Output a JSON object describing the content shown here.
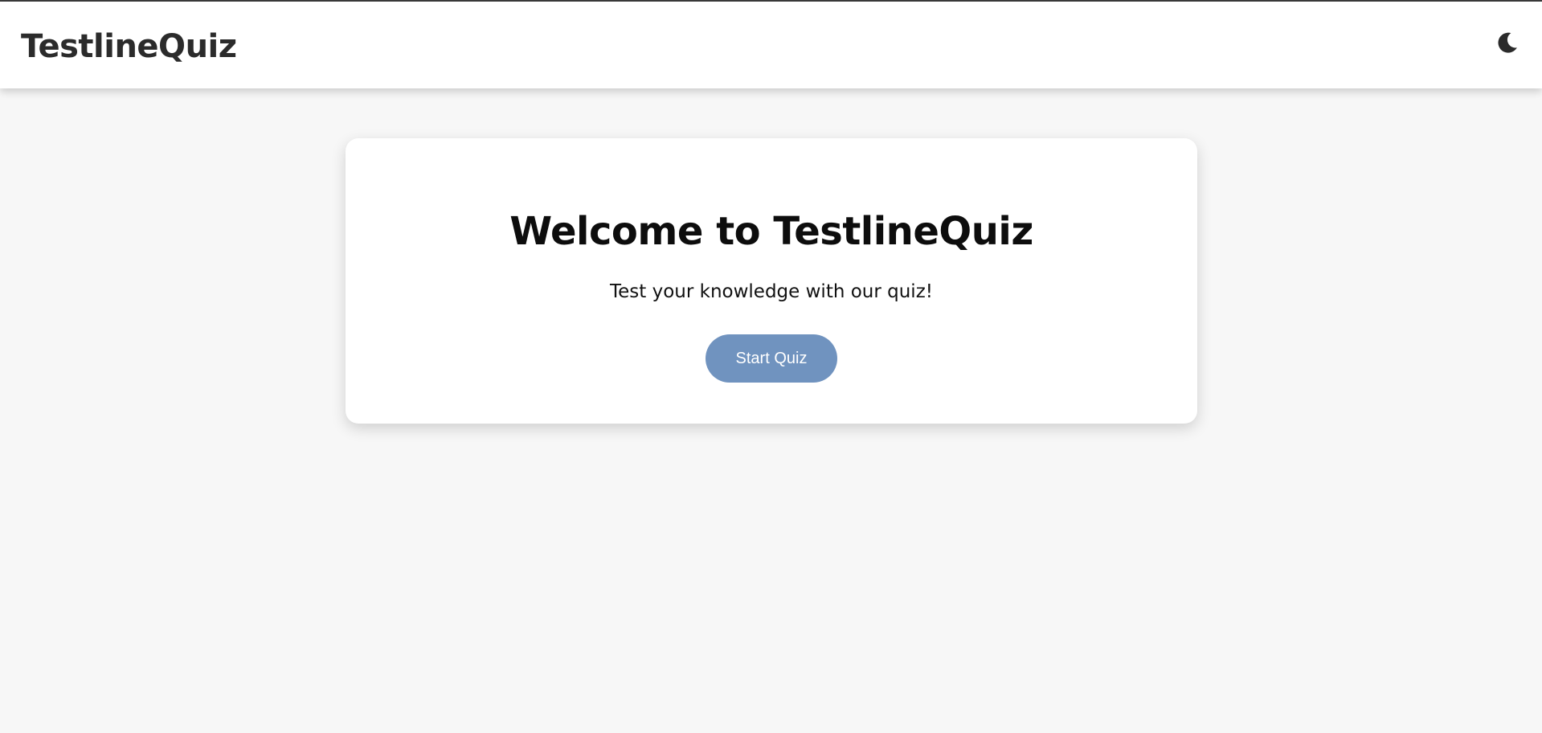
{
  "header": {
    "brand": "TestlineQuiz",
    "theme_toggle_icon": "moon-icon"
  },
  "welcome": {
    "title": "Welcome to TestlineQuiz",
    "subtitle": "Test your knowledge with our quiz!",
    "start_label": "Start Quiz"
  },
  "colors": {
    "background": "#f7f7f7",
    "accent": "#7093bf",
    "text": "#2b2b2b"
  }
}
